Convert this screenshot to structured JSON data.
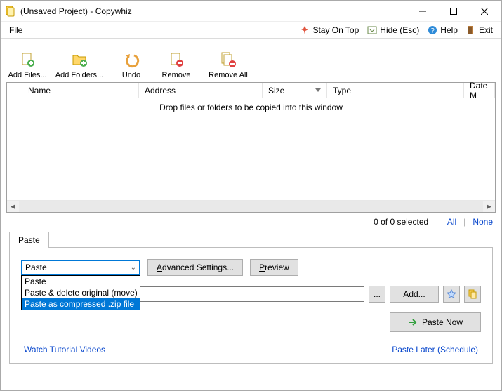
{
  "window": {
    "title": "(Unsaved Project) - Copywhiz"
  },
  "menu": {
    "file": "File",
    "stay_on_top": "Stay On Top",
    "hide": "Hide (Esc)",
    "help": "Help",
    "exit": "Exit"
  },
  "toolbar": {
    "add_files": "Add Files...",
    "add_folders": "Add Folders...",
    "undo": "Undo",
    "remove": "Remove",
    "remove_all": "Remove All"
  },
  "columns": {
    "name": "Name",
    "address": "Address",
    "size": "Size",
    "type": "Type",
    "date": "Date M"
  },
  "drop_hint": "Drop files or folders to be copied into this window",
  "status": {
    "selected": "0 of 0 selected",
    "all": "All",
    "none": "None"
  },
  "tabs": {
    "paste": "Paste"
  },
  "paste": {
    "combo_value": "Paste",
    "options": [
      "Paste",
      "Paste & delete original (move)",
      "Paste as compressed .zip file"
    ],
    "advanced": "Advanced Settings...",
    "preview": "Preview",
    "browse": "...",
    "add": "Add...",
    "paste_now": "Paste Now"
  },
  "footer": {
    "tutorials": "Watch Tutorial Videos",
    "schedule": "Paste Later (Schedule)"
  }
}
